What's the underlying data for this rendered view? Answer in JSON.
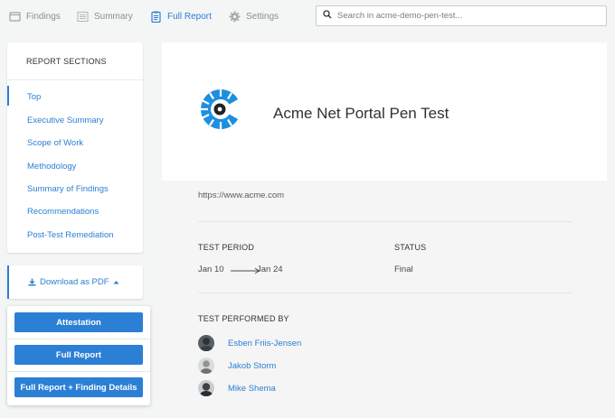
{
  "nav": {
    "tabs": [
      {
        "label": "Findings",
        "icon": "folder-icon",
        "active": false
      },
      {
        "label": "Summary",
        "icon": "list-icon",
        "active": false
      },
      {
        "label": "Full Report",
        "icon": "clipboard-icon",
        "active": true
      },
      {
        "label": "Settings",
        "icon": "gear-icon",
        "active": false
      }
    ],
    "search": {
      "placeholder": "Search in acme-demo-pen-test...",
      "value": ""
    }
  },
  "sidebar": {
    "title": "REPORT SECTIONS",
    "items": [
      {
        "label": "Top",
        "active": true
      },
      {
        "label": "Executive Summary"
      },
      {
        "label": "Scope of Work"
      },
      {
        "label": "Methodology"
      },
      {
        "label": "Summary of Findings"
      },
      {
        "label": "Recommendations"
      },
      {
        "label": "Post-Test Remediation"
      }
    ]
  },
  "download": {
    "label": "Download as PDF",
    "options": [
      "Attestation",
      "Full Report",
      "Full Report + Finding Details"
    ]
  },
  "report": {
    "title": "Acme Net Portal Pen Test",
    "url": "https://www.acme.com",
    "test_period_label": "TEST PERIOD",
    "period_start": "Jan 10",
    "period_end": "Jan 24",
    "status_label": "STATUS",
    "status_value": "Final",
    "performed_by_label": "TEST PERFORMED BY",
    "testers": [
      "Esben Friis-Jensen",
      "Jakob Storm",
      "Mike Shema"
    ]
  },
  "colors": {
    "accent": "#2b7fd4",
    "background": "#f4f5f5",
    "logo_blue": "#1d8fe0",
    "logo_dark": "#1f2327"
  }
}
